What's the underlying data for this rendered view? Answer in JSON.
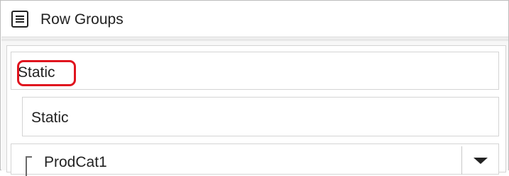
{
  "header": {
    "icon": "list-icon",
    "title": "Row Groups"
  },
  "groups": {
    "group_label": "Static",
    "child_label": "Static",
    "field": {
      "icon": "bracket-icon",
      "label": "ProdCat1",
      "dropdown_icon": "chevron-down-icon"
    }
  },
  "colors": {
    "highlight": "#e0141e",
    "border": "#d4d4d4",
    "text": "#222222"
  }
}
